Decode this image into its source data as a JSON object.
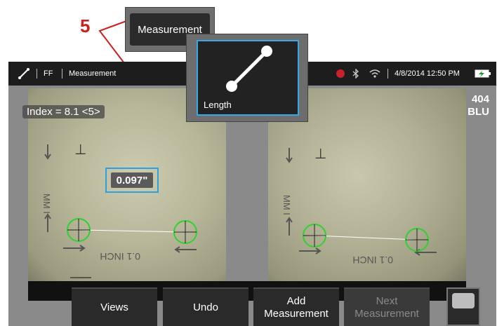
{
  "callout": {
    "number": "5",
    "tab_label": "Measurement",
    "line_color": "#cc1f1f"
  },
  "statusbar": {
    "mode_icon": "measure-line-icon",
    "focus_mode": "FF",
    "title": "Measurement",
    "record_icon": "record-dot-icon",
    "bluetooth_icon": "bluetooth-icon",
    "wifi_icon": "wifi-icon",
    "datetime": "4/8/2014  12:50 PM",
    "battery_icon": "battery-charging-icon"
  },
  "overlay": {
    "index_label": "Index = 8.1 <5>",
    "side_code_line1": "404",
    "side_code_line2": "BLU",
    "measurement_value": "0.097\""
  },
  "popup": {
    "tool_icon": "length-tool-icon",
    "tool_label": "Length",
    "accent_color": "#39a7e6"
  },
  "buttons": {
    "views": "Views",
    "undo": "Undo",
    "add_line1": "Add",
    "add_line2": "Measurement",
    "next_line1": "Next",
    "next_line2": "Measurement"
  },
  "image_text": {
    "mm_label": "MM I",
    "inch_label": "0.1 INCH"
  },
  "colors": {
    "cursor_green": "#2fd12f",
    "measure_line": "#ffffff",
    "selection_blue": "#2ea0e0"
  }
}
